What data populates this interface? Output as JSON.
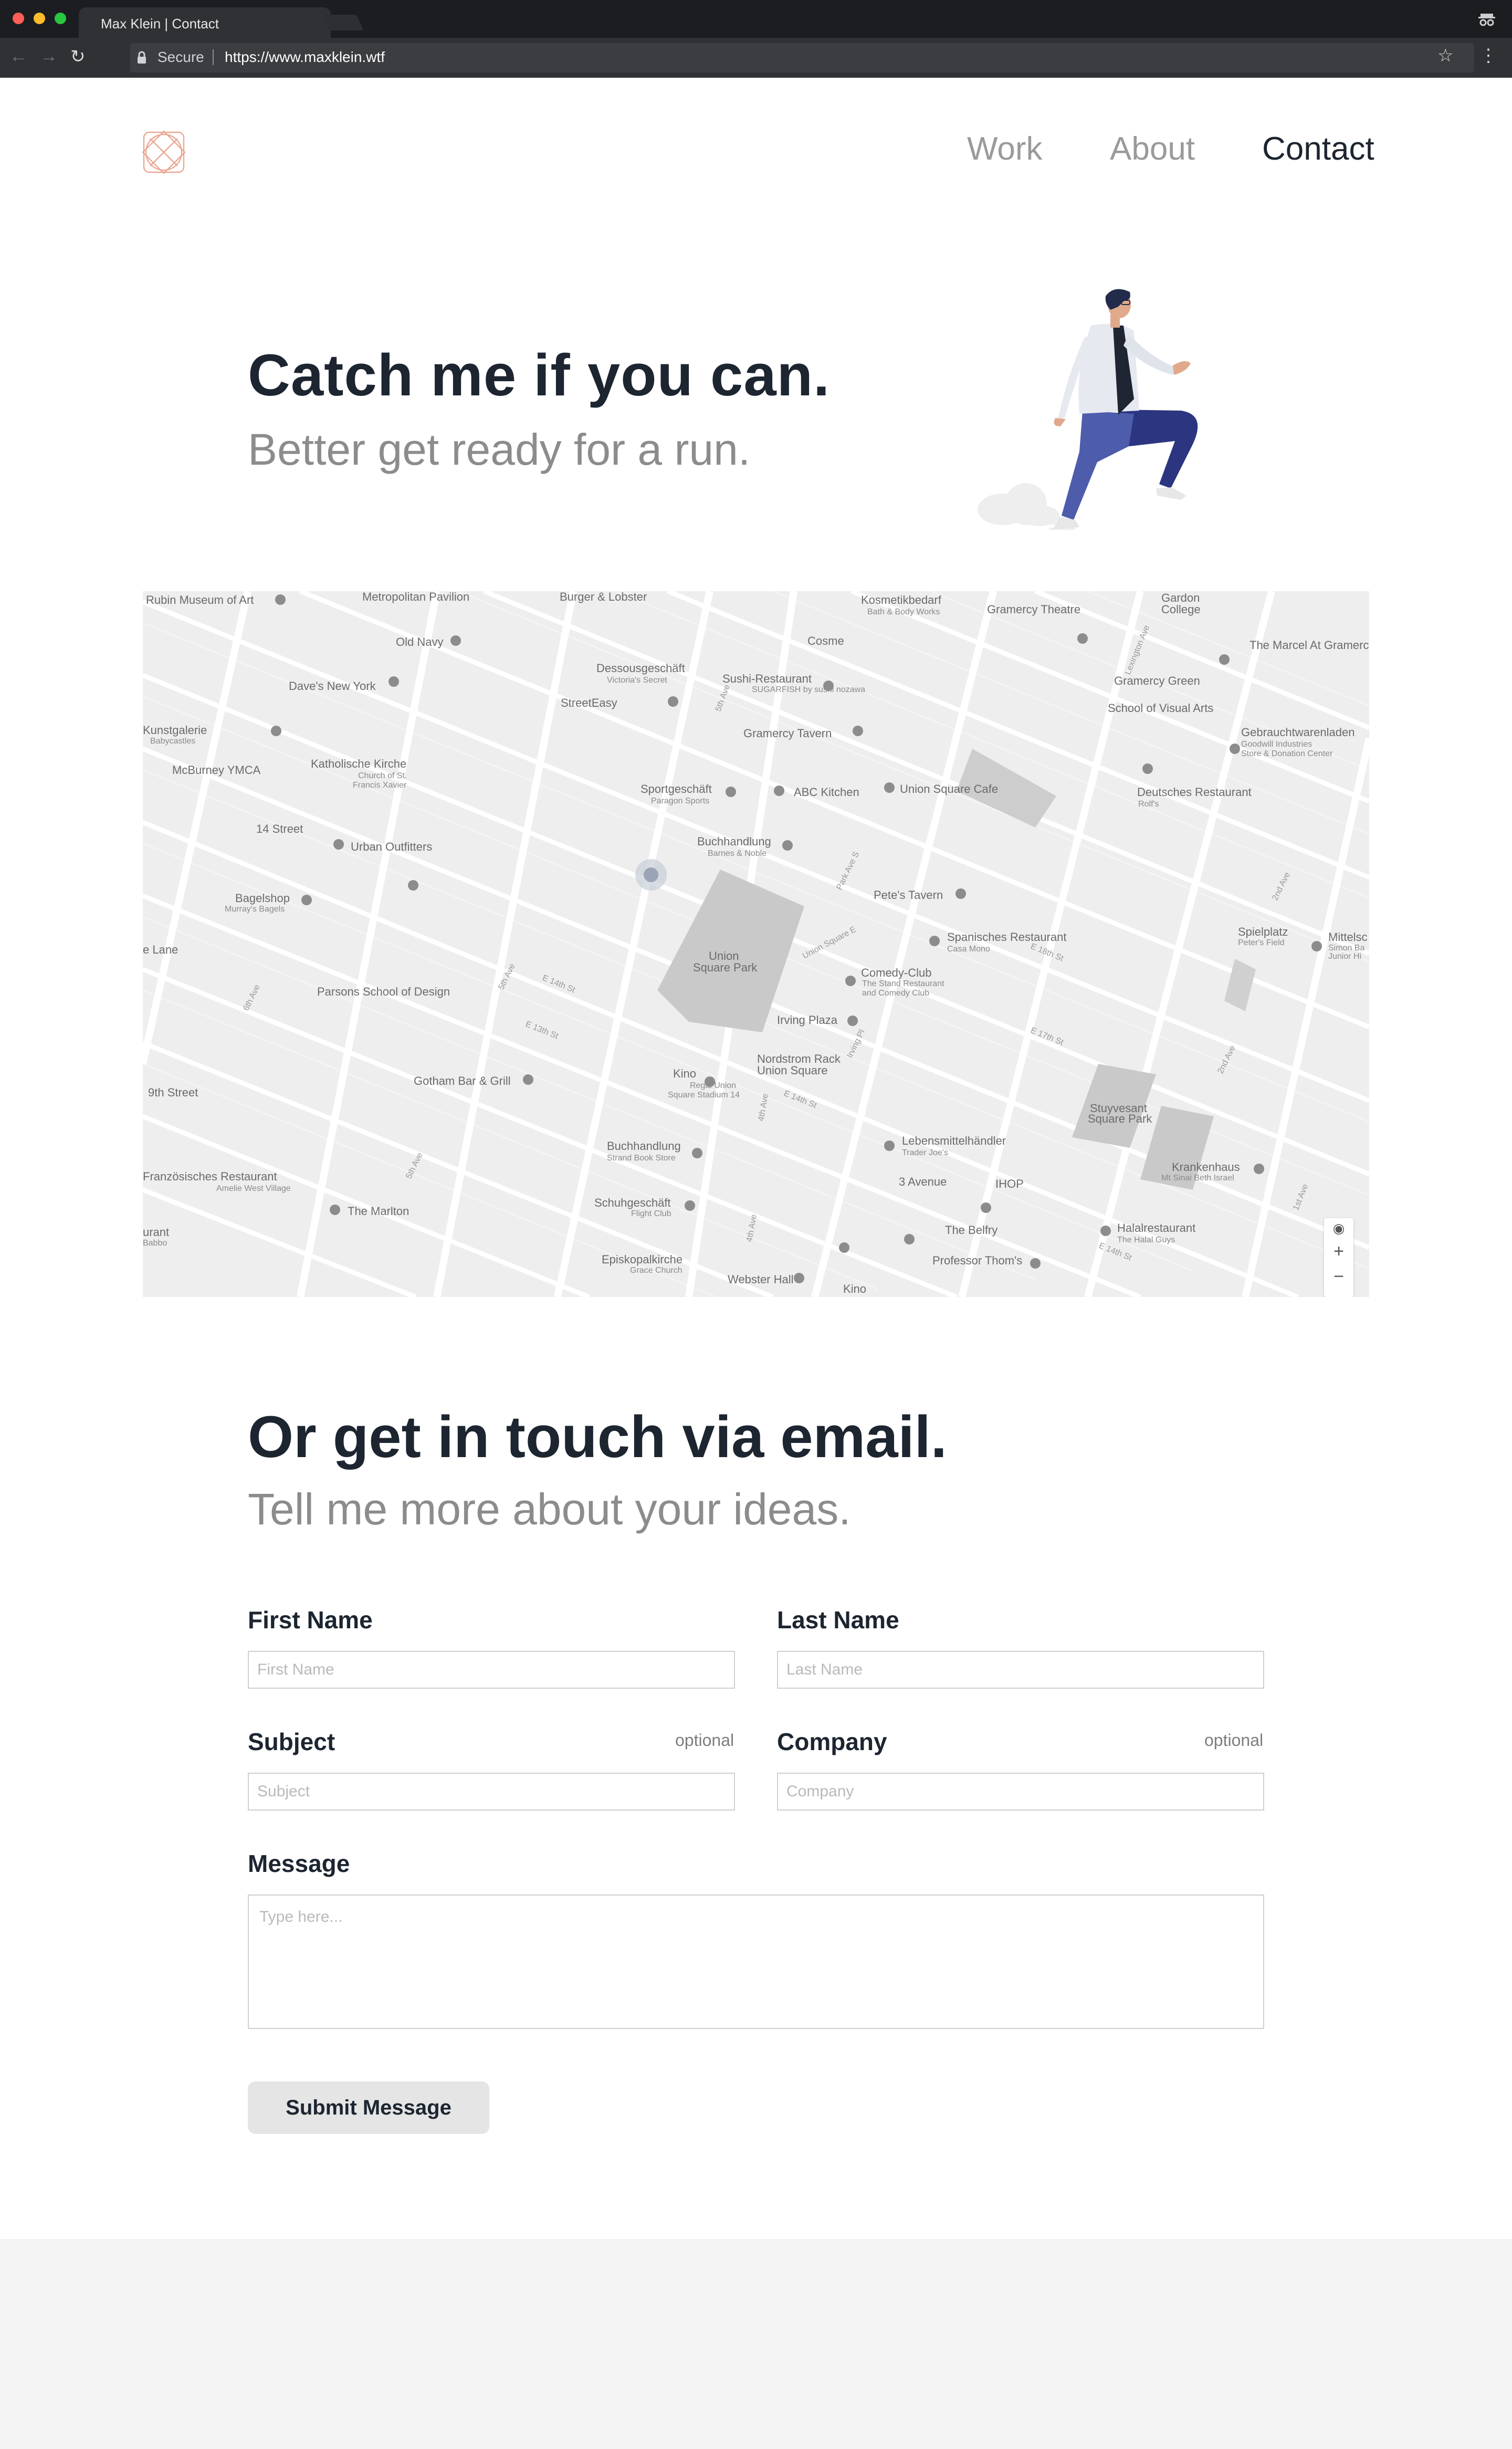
{
  "browser": {
    "tab_title": "Max Klein | Contact",
    "secure_label": "Secure",
    "url": "https://www.maxklein.wtf"
  },
  "nav": {
    "items": [
      {
        "label": "Work"
      },
      {
        "label": "About"
      },
      {
        "label": "Contact",
        "active": true
      }
    ]
  },
  "hero": {
    "title": "Catch me if you can.",
    "subtitle": "Better get ready for a run."
  },
  "map": {
    "places": [
      "Rubin Museum of Art",
      "Metropolitan Pavilion",
      "Burger & Lobster",
      "Kosmetikbedarf",
      "Bath & Body Works",
      "Gramercy Theatre",
      "Gardon College",
      "Old Navy",
      "Cosme",
      "The Marcel At Gramercy",
      "Dave's New York",
      "Dessousgeschäft",
      "Victoria's Secret",
      "Sushi-Restaurant",
      "SUGARFISH by sushi nozawa",
      "Gramercy Green",
      "StreetEasy",
      "School of Visual Arts",
      "Kunstgalerie",
      "Babycastles",
      "Gramercy Tavern",
      "Gebrauchtwarenladen",
      "Goodwill Industries Store & Donation Center",
      "McBurney YMCA",
      "Katholische Kirche",
      "Church of St. Francis Xavier",
      "Sportgeschäft",
      "Paragon Sports",
      "ABC Kitchen",
      "Union Square Cafe",
      "Deutsches Restaurant",
      "Rolf's",
      "14 Street",
      "Buchhandlung",
      "Barnes & Noble",
      "Urban Outfitters",
      "Bagelshop",
      "Murray's Bagels",
      "Pete's Tavern",
      "Spielplatz",
      "Peter's Field",
      "Mittelschule",
      "Simon Baruch Junior High",
      "Union Square Park",
      "Spanisches Restaurant",
      "Casa Mono",
      "Comedy-Club",
      "The Stand Restaurant and Comedy Club",
      "Parsons School of Design",
      "Irving Plaza",
      "Nordstrom Rack",
      "Union Square",
      "Kino",
      "Regal Union Square Stadium 14",
      "Gotham Bar & Grill",
      "9th Street",
      "Stuyvesant Square Park",
      "Buchhandlung",
      "Strand Book Store",
      "Lebensmittelhändler",
      "Trader Joe's",
      "Krankenhaus",
      "Mt Sinai Beth Israel",
      "Französisches Restaurant",
      "Amelie West Village",
      "3 Avenue",
      "IHOP",
      "The Marlton",
      "Schuhgeschäft",
      "Flight Club",
      "Halalrestaurant",
      "The Halal Guys",
      "The Belfry",
      "Professor Thom's",
      "Episkopalkirche",
      "Grace Church",
      "Webster Hall",
      "Kino"
    ],
    "streets": [
      "E 14th St",
      "5th Ave",
      "Park Ave S",
      "Union Square E",
      "Irving Pl",
      "2nd Ave",
      "4th Ave",
      "1st Ave",
      "Lexington Ave",
      "6th Ave",
      "E 13th St",
      "E 17th St"
    ],
    "controls": {
      "zoom_in": "+",
      "zoom_out": "−"
    }
  },
  "contact": {
    "title": "Or get in touch via email.",
    "subtitle": "Tell me more about your ideas.",
    "fields": {
      "first_name": {
        "label": "First Name",
        "placeholder": "First Name"
      },
      "last_name": {
        "label": "Last Name",
        "placeholder": "Last Name"
      },
      "subject": {
        "label": "Subject",
        "optional": "optional",
        "placeholder": "Subject"
      },
      "company": {
        "label": "Company",
        "optional": "optional",
        "placeholder": "Company"
      },
      "message": {
        "label": "Message",
        "placeholder": "Type here..."
      }
    },
    "submit_label": "Submit Message"
  },
  "colors": {
    "text_dark": "#1c2530",
    "text_muted": "#8c8c8c",
    "logo": "#e9a995",
    "runner_pants": "#4e5cac",
    "runner_shirt": "#e6e9ef"
  }
}
